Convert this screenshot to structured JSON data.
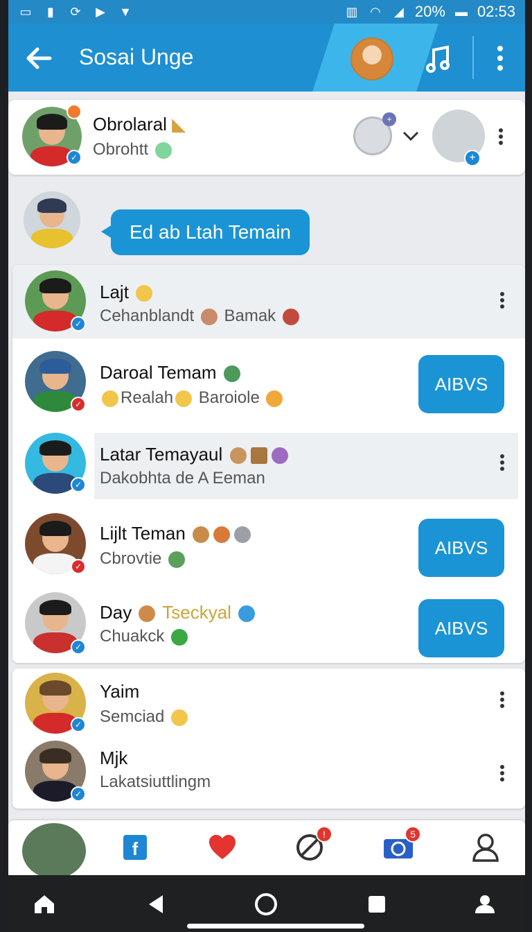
{
  "status_bar": {
    "battery": "20%",
    "time": "02:53"
  },
  "app_bar": {
    "title": "Sosai Unge"
  },
  "profile": {
    "name": "Obrolaral",
    "subtitle": "Obrohtt"
  },
  "chat": {
    "bubble_text": "Ed ab Ltah Temain"
  },
  "list": [
    {
      "name": "Lajt",
      "subtitle": "Cehanblandt",
      "subtitle_extra": "Bamak"
    },
    {
      "name": "Daroal Temam",
      "subtitle": "Realah",
      "subtitle_extra": "Baroiole",
      "action": "AIBVS"
    },
    {
      "name": "Latar Temayaul",
      "subtitle": "Dakobhta de A Eeman"
    },
    {
      "name": "Lijlt Teman",
      "subtitle": "Cbrovtie",
      "action": "AIBVS"
    },
    {
      "name": "Day",
      "name_extra": "Tseckyal",
      "subtitle": "Chuakck",
      "action": "AIBVS"
    }
  ],
  "list2": [
    {
      "name": "Yaim",
      "subtitle": "Semciad"
    },
    {
      "name": "Mjk",
      "subtitle": "Lakatsiuttlingm"
    }
  ],
  "tab_bar": {
    "badge_chat": "!",
    "badge_camera": "5"
  },
  "colors": {
    "primary": "#1e8fd1",
    "accent": "#1b94d5",
    "badge": "#e0352f"
  }
}
